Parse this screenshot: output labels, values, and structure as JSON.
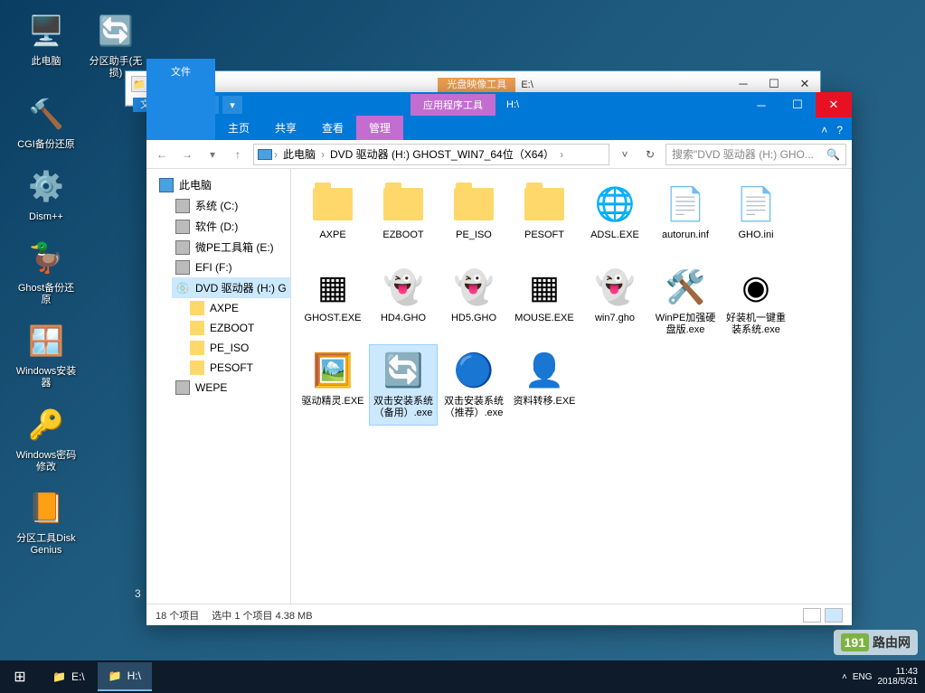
{
  "desktop": {
    "icons": [
      {
        "label": "此电脑",
        "glyph": "🖥️"
      },
      {
        "label": "分区助手(无损)",
        "glyph": "🔄"
      },
      {
        "label": "CGI备份还原",
        "glyph": "🔨"
      },
      {
        "label": "Dism++",
        "glyph": "⚙️"
      },
      {
        "label": "Ghost备份还原",
        "glyph": "🦆"
      },
      {
        "label": "Windows安装器",
        "glyph": "🪟"
      },
      {
        "label": "Windows密码修改",
        "glyph": "🔑"
      },
      {
        "label": "分区工具DiskGenius",
        "glyph": "📙"
      }
    ],
    "stray_number": "3"
  },
  "back_window": {
    "context_tab": "光盘映像工具",
    "title": "E:\\",
    "file_tab_partial": "文"
  },
  "window": {
    "context_tab": "应用程序工具",
    "drive": "H:\\",
    "tabs": {
      "file": "文件",
      "home": "主页",
      "share": "共享",
      "view": "查看",
      "manage": "管理"
    },
    "breadcrumbs": [
      "此电脑",
      "DVD 驱动器 (H:) GHOST_WIN7_64位（X64）"
    ],
    "search_placeholder": "搜索\"DVD 驱动器 (H:) GHO...",
    "tree": {
      "root": "此电脑",
      "drives": [
        {
          "label": "系统 (C:)"
        },
        {
          "label": "软件 (D:)"
        },
        {
          "label": "微PE工具箱 (E:)"
        },
        {
          "label": "EFI (F:)"
        },
        {
          "label": "DVD 驱动器 (H:) G",
          "selected": true,
          "children": [
            "AXPE",
            "EZBOOT",
            "PE_ISO",
            "PESOFT"
          ]
        },
        {
          "label": "WEPE"
        }
      ]
    },
    "files": [
      {
        "name": "AXPE",
        "type": "folder"
      },
      {
        "name": "EZBOOT",
        "type": "folder"
      },
      {
        "name": "PE_ISO",
        "type": "folder"
      },
      {
        "name": "PESOFT",
        "type": "folder"
      },
      {
        "name": "ADSL.EXE",
        "type": "exe",
        "glyph": "🌐"
      },
      {
        "name": "autorun.inf",
        "type": "inf",
        "glyph": "📄"
      },
      {
        "name": "GHO.ini",
        "type": "ini",
        "glyph": "📄"
      },
      {
        "name": "GHOST.EXE",
        "type": "exe",
        "glyph": "▦"
      },
      {
        "name": "HD4.GHO",
        "type": "gho",
        "glyph": "👻"
      },
      {
        "name": "HD5.GHO",
        "type": "gho",
        "glyph": "👻"
      },
      {
        "name": "MOUSE.EXE",
        "type": "exe",
        "glyph": "▦"
      },
      {
        "name": "win7.gho",
        "type": "gho",
        "glyph": "👻"
      },
      {
        "name": "WinPE加强硬盘版.exe",
        "type": "exe",
        "glyph": "🛠️"
      },
      {
        "name": "好装机一键重装系统.exe",
        "type": "exe",
        "glyph": "◉"
      },
      {
        "name": "驱动精灵.EXE",
        "type": "exe",
        "glyph": "🖼️"
      },
      {
        "name": "双击安装系统（备用）.exe",
        "type": "exe",
        "glyph": "🔄",
        "selected": true
      },
      {
        "name": "双击安装系统（推荐）.exe",
        "type": "exe",
        "glyph": "🔵"
      },
      {
        "name": "资料转移.EXE",
        "type": "exe",
        "glyph": "👤"
      }
    ],
    "status": {
      "count": "18 个项目",
      "selection": "选中 1 个项目  4.38 MB"
    }
  },
  "taskbar": {
    "items": [
      {
        "label": "E:\\",
        "active": false
      },
      {
        "label": "H:\\",
        "active": true
      }
    ],
    "tray": {
      "ime": "ENG",
      "time": "11:43",
      "date": "2018/5/31"
    }
  },
  "watermark": {
    "num": "191",
    "text": "路由网"
  }
}
